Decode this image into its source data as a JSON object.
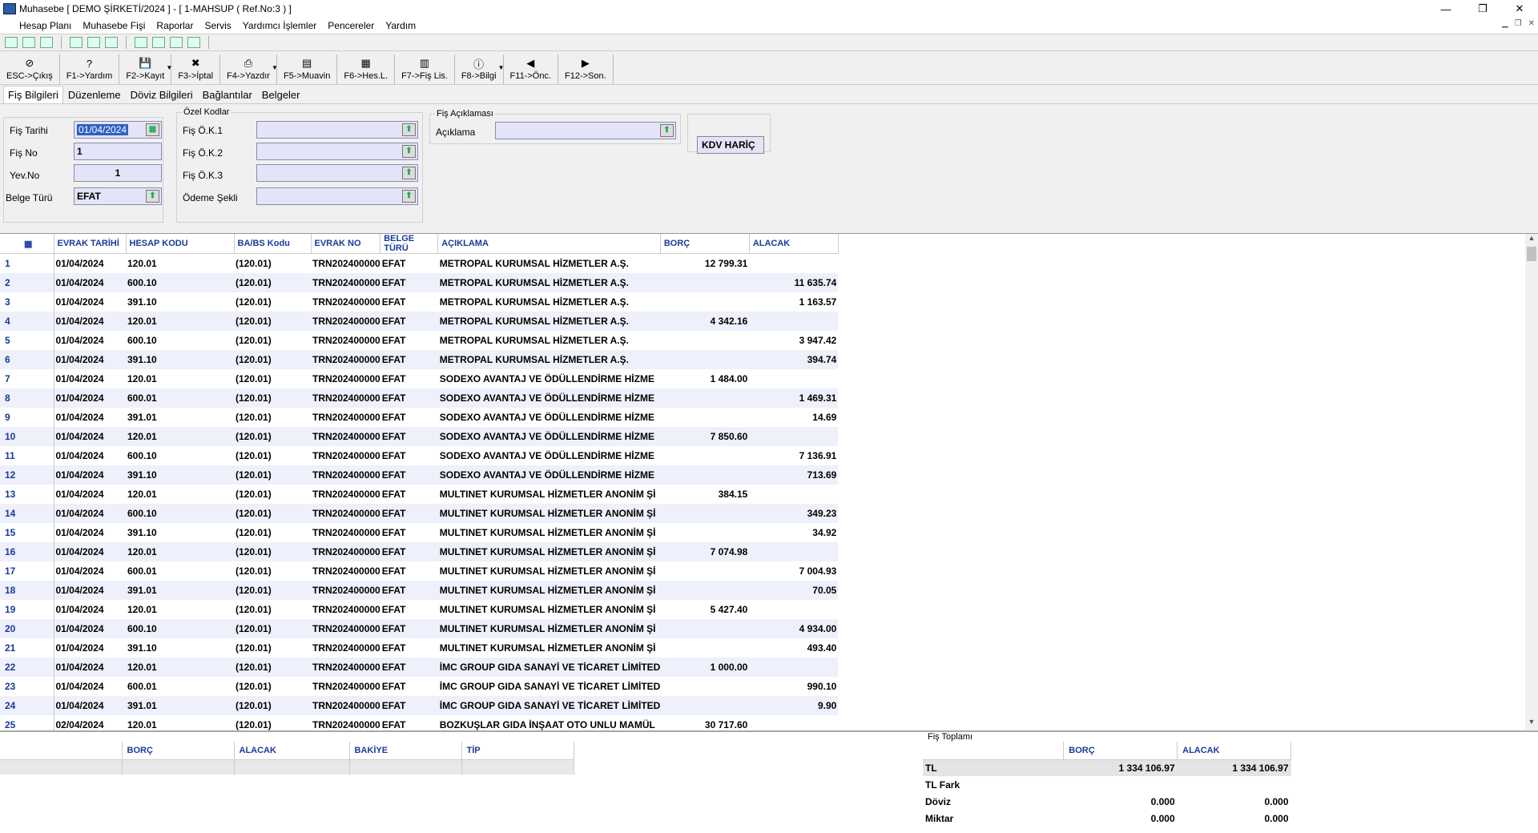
{
  "window": {
    "title": "Muhasebe [ DEMO ŞİRKETİ/2024 ]  - [ 1-MAHSUP ( Ref.No:3 ) ]",
    "minimize": "—",
    "restore": "❐",
    "close": "✕"
  },
  "menu": [
    "Hesap Planı",
    "Muhasebe Fişi",
    "Raporlar",
    "Servis",
    "Yardımcı İşlemler",
    "Pencereler",
    "Yardım"
  ],
  "fkeys": [
    {
      "label": "ESC->Çıkış",
      "icon": "exit-icon",
      "glyph": "⊘"
    },
    {
      "label": "F1->Yardım",
      "icon": "help-icon",
      "glyph": "?"
    },
    {
      "label": "F2->Kayıt",
      "icon": "save-icon",
      "glyph": "💾"
    },
    {
      "label": "F3->İptal",
      "icon": "cancel-icon",
      "glyph": "✖"
    },
    {
      "label": "F4->Yazdır",
      "icon": "print-icon",
      "glyph": "⎙"
    },
    {
      "label": "F5->Muavin",
      "icon": "ledger-icon",
      "glyph": "▤"
    },
    {
      "label": "F6->Hes.L.",
      "icon": "accounts-list-icon",
      "glyph": "▦"
    },
    {
      "label": "F7->Fiş Lis.",
      "icon": "voucher-list-icon",
      "glyph": "▥"
    },
    {
      "label": "F8->Bilgi",
      "icon": "info-icon",
      "glyph": "ⓘ"
    },
    {
      "label": "F11->Önc.",
      "icon": "prev-arrow-icon",
      "glyph": "◀"
    },
    {
      "label": "F12->Son.",
      "icon": "next-arrow-icon",
      "glyph": "▶"
    }
  ],
  "tabs": [
    "Fiş Bilgileri",
    "Düzenleme",
    "Döviz Bilgileri",
    "Bağlantılar",
    "Belgeler"
  ],
  "form": {
    "fis_tarihi_label": "Fiş Tarihi",
    "fis_tarihi": "01/04/2024",
    "fis_no_label": "Fiş No",
    "fis_no": "1",
    "yev_no_label": "Yev.No",
    "yev_no": "1",
    "belge_turu_label": "Belge Türü",
    "belge_turu": "EFAT",
    "ozel_kodlar_title": "Özel Kodlar",
    "ok1_label": "Fiş Ö.K.1",
    "ok2_label": "Fiş Ö.K.2",
    "ok3_label": "Fiş Ö.K.3",
    "odeme_label": "Ödeme Şekli",
    "aciklama_title": "Fiş Açıklaması",
    "aciklama_label": "Açıklama",
    "kdv": "KDV HARİÇ"
  },
  "grid": {
    "columns": [
      "EVRAK TARİHİ",
      "HESAP KODU",
      "BA/BS Kodu",
      "EVRAK NO",
      "BELGE TÜRÜ",
      "AÇIKLAMA",
      "BORÇ",
      "ALACAK"
    ],
    "rows": [
      [
        "1",
        "01/04/2024",
        "120.01",
        "(120.01)",
        "TRN202400000",
        "EFAT",
        "METROPAL KURUMSAL HİZMETLER A.Ş.",
        "12 799.31",
        ""
      ],
      [
        "2",
        "01/04/2024",
        "600.10",
        "(120.01)",
        "TRN202400000",
        "EFAT",
        "METROPAL KURUMSAL HİZMETLER A.Ş.",
        "",
        "11 635.74"
      ],
      [
        "3",
        "01/04/2024",
        "391.10",
        "(120.01)",
        "TRN202400000",
        "EFAT",
        "METROPAL KURUMSAL HİZMETLER A.Ş.",
        "",
        "1 163.57"
      ],
      [
        "4",
        "01/04/2024",
        "120.01",
        "(120.01)",
        "TRN202400000",
        "EFAT",
        "METROPAL KURUMSAL HİZMETLER A.Ş.",
        "4 342.16",
        ""
      ],
      [
        "5",
        "01/04/2024",
        "600.10",
        "(120.01)",
        "TRN202400000",
        "EFAT",
        "METROPAL KURUMSAL HİZMETLER A.Ş.",
        "",
        "3 947.42"
      ],
      [
        "6",
        "01/04/2024",
        "391.10",
        "(120.01)",
        "TRN202400000",
        "EFAT",
        "METROPAL KURUMSAL HİZMETLER A.Ş.",
        "",
        "394.74"
      ],
      [
        "7",
        "01/04/2024",
        "120.01",
        "(120.01)",
        "TRN202400000",
        "EFAT",
        "SODEXO AVANTAJ VE ÖDÜLLENDİRME HİZME",
        "1 484.00",
        ""
      ],
      [
        "8",
        "01/04/2024",
        "600.01",
        "(120.01)",
        "TRN202400000",
        "EFAT",
        "SODEXO AVANTAJ VE ÖDÜLLENDİRME HİZME",
        "",
        "1 469.31"
      ],
      [
        "9",
        "01/04/2024",
        "391.01",
        "(120.01)",
        "TRN202400000",
        "EFAT",
        "SODEXO AVANTAJ VE ÖDÜLLENDİRME HİZME",
        "",
        "14.69"
      ],
      [
        "10",
        "01/04/2024",
        "120.01",
        "(120.01)",
        "TRN202400000",
        "EFAT",
        "SODEXO AVANTAJ VE ÖDÜLLENDİRME HİZME",
        "7 850.60",
        ""
      ],
      [
        "11",
        "01/04/2024",
        "600.10",
        "(120.01)",
        "TRN202400000",
        "EFAT",
        "SODEXO AVANTAJ VE ÖDÜLLENDİRME HİZME",
        "",
        "7 136.91"
      ],
      [
        "12",
        "01/04/2024",
        "391.10",
        "(120.01)",
        "TRN202400000",
        "EFAT",
        "SODEXO AVANTAJ VE ÖDÜLLENDİRME HİZME",
        "",
        "713.69"
      ],
      [
        "13",
        "01/04/2024",
        "120.01",
        "(120.01)",
        "TRN202400000",
        "EFAT",
        "MULTINET KURUMSAL HİZMETLER ANONİM Şİ",
        "384.15",
        ""
      ],
      [
        "14",
        "01/04/2024",
        "600.10",
        "(120.01)",
        "TRN202400000",
        "EFAT",
        "MULTINET KURUMSAL HİZMETLER ANONİM Şİ",
        "",
        "349.23"
      ],
      [
        "15",
        "01/04/2024",
        "391.10",
        "(120.01)",
        "TRN202400000",
        "EFAT",
        "MULTINET KURUMSAL HİZMETLER ANONİM Şİ",
        "",
        "34.92"
      ],
      [
        "16",
        "01/04/2024",
        "120.01",
        "(120.01)",
        "TRN202400000",
        "EFAT",
        "MULTINET KURUMSAL HİZMETLER ANONİM Şİ",
        "7 074.98",
        ""
      ],
      [
        "17",
        "01/04/2024",
        "600.01",
        "(120.01)",
        "TRN202400000",
        "EFAT",
        "MULTINET KURUMSAL HİZMETLER ANONİM Şİ",
        "",
        "7 004.93"
      ],
      [
        "18",
        "01/04/2024",
        "391.01",
        "(120.01)",
        "TRN202400000",
        "EFAT",
        "MULTINET KURUMSAL HİZMETLER ANONİM Şİ",
        "",
        "70.05"
      ],
      [
        "19",
        "01/04/2024",
        "120.01",
        "(120.01)",
        "TRN202400000",
        "EFAT",
        "MULTINET KURUMSAL HİZMETLER ANONİM Şİ",
        "5 427.40",
        ""
      ],
      [
        "20",
        "01/04/2024",
        "600.10",
        "(120.01)",
        "TRN202400000",
        "EFAT",
        "MULTINET KURUMSAL HİZMETLER ANONİM Şİ",
        "",
        "4 934.00"
      ],
      [
        "21",
        "01/04/2024",
        "391.10",
        "(120.01)",
        "TRN202400000",
        "EFAT",
        "MULTINET KURUMSAL HİZMETLER ANONİM Şİ",
        "",
        "493.40"
      ],
      [
        "22",
        "01/04/2024",
        "120.01",
        "(120.01)",
        "TRN202400000",
        "EFAT",
        "İMC GROUP GIDA SANAYİ VE TİCARET LİMİTED",
        "1 000.00",
        ""
      ],
      [
        "23",
        "01/04/2024",
        "600.01",
        "(120.01)",
        "TRN202400000",
        "EFAT",
        "İMC GROUP GIDA SANAYİ VE TİCARET LİMİTED",
        "",
        "990.10"
      ],
      [
        "24",
        "01/04/2024",
        "391.01",
        "(120.01)",
        "TRN202400000",
        "EFAT",
        "İMC GROUP GIDA SANAYİ VE TİCARET LİMİTED",
        "",
        "9.90"
      ],
      [
        "25",
        "02/04/2024",
        "120.01",
        "(120.01)",
        "TRN202400000",
        "EFAT",
        "BOZKUŞLAR GIDA İNŞAAT OTO UNLU MAMÜL",
        "30 717.60",
        ""
      ]
    ]
  },
  "account_summary": {
    "columns": [
      "",
      "BORÇ",
      "ALACAK",
      "BAKİYE",
      "TİP"
    ]
  },
  "totals": {
    "title": "Fiş Toplamı",
    "columns": [
      "",
      "BORÇ",
      "ALACAK"
    ],
    "rows": [
      [
        "TL",
        "1 334 106.97",
        "1 334 106.97"
      ],
      [
        "TL Fark",
        "",
        ""
      ],
      [
        "Döviz",
        "0.000",
        "0.000"
      ],
      [
        "Miktar",
        "0.000",
        "0.000"
      ]
    ]
  }
}
